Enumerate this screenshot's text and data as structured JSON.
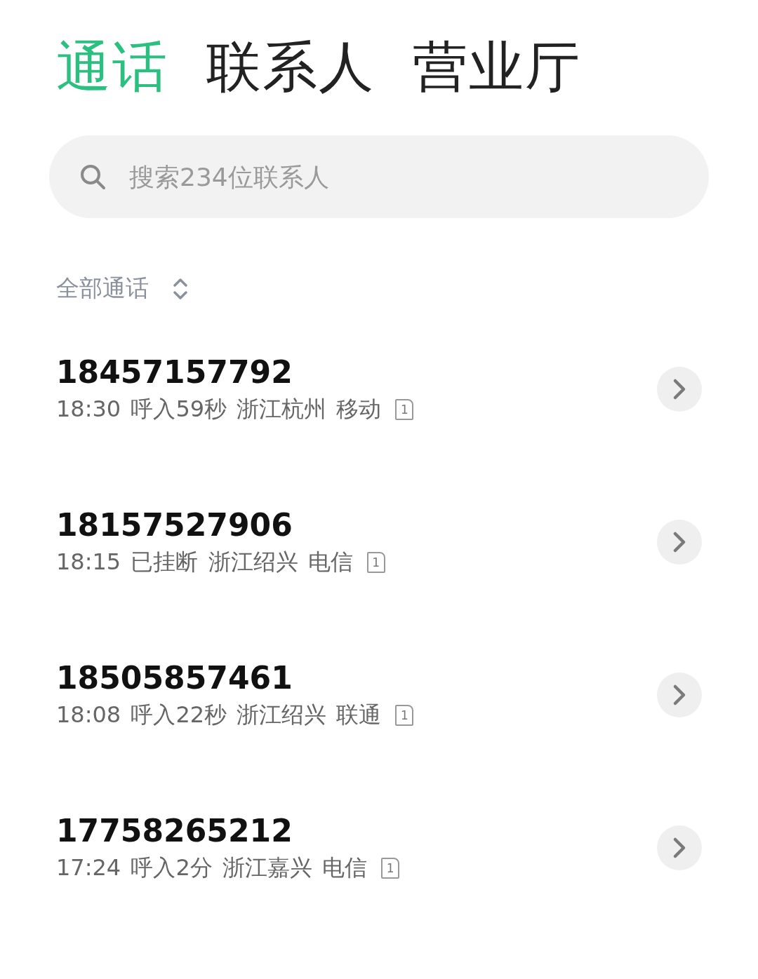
{
  "tabs": [
    {
      "label": "通话",
      "selected": true
    },
    {
      "label": "联系人",
      "selected": false
    },
    {
      "label": "营业厅",
      "selected": false
    }
  ],
  "search": {
    "placeholder": "搜索234位联系人"
  },
  "filter": {
    "label": "全部通话"
  },
  "calls": [
    {
      "number": "18457157792",
      "detail": "18:30 呼入59秒 浙江杭州 移动",
      "sim": "1"
    },
    {
      "number": "18157527906",
      "detail": "18:15 已挂断 浙江绍兴 电信",
      "sim": "1"
    },
    {
      "number": "18505857461",
      "detail": "18:08 呼入22秒 浙江绍兴 联通",
      "sim": "1"
    },
    {
      "number": "17758265212",
      "detail": "17:24 呼入2分 浙江嘉兴 电信",
      "sim": "1"
    }
  ]
}
